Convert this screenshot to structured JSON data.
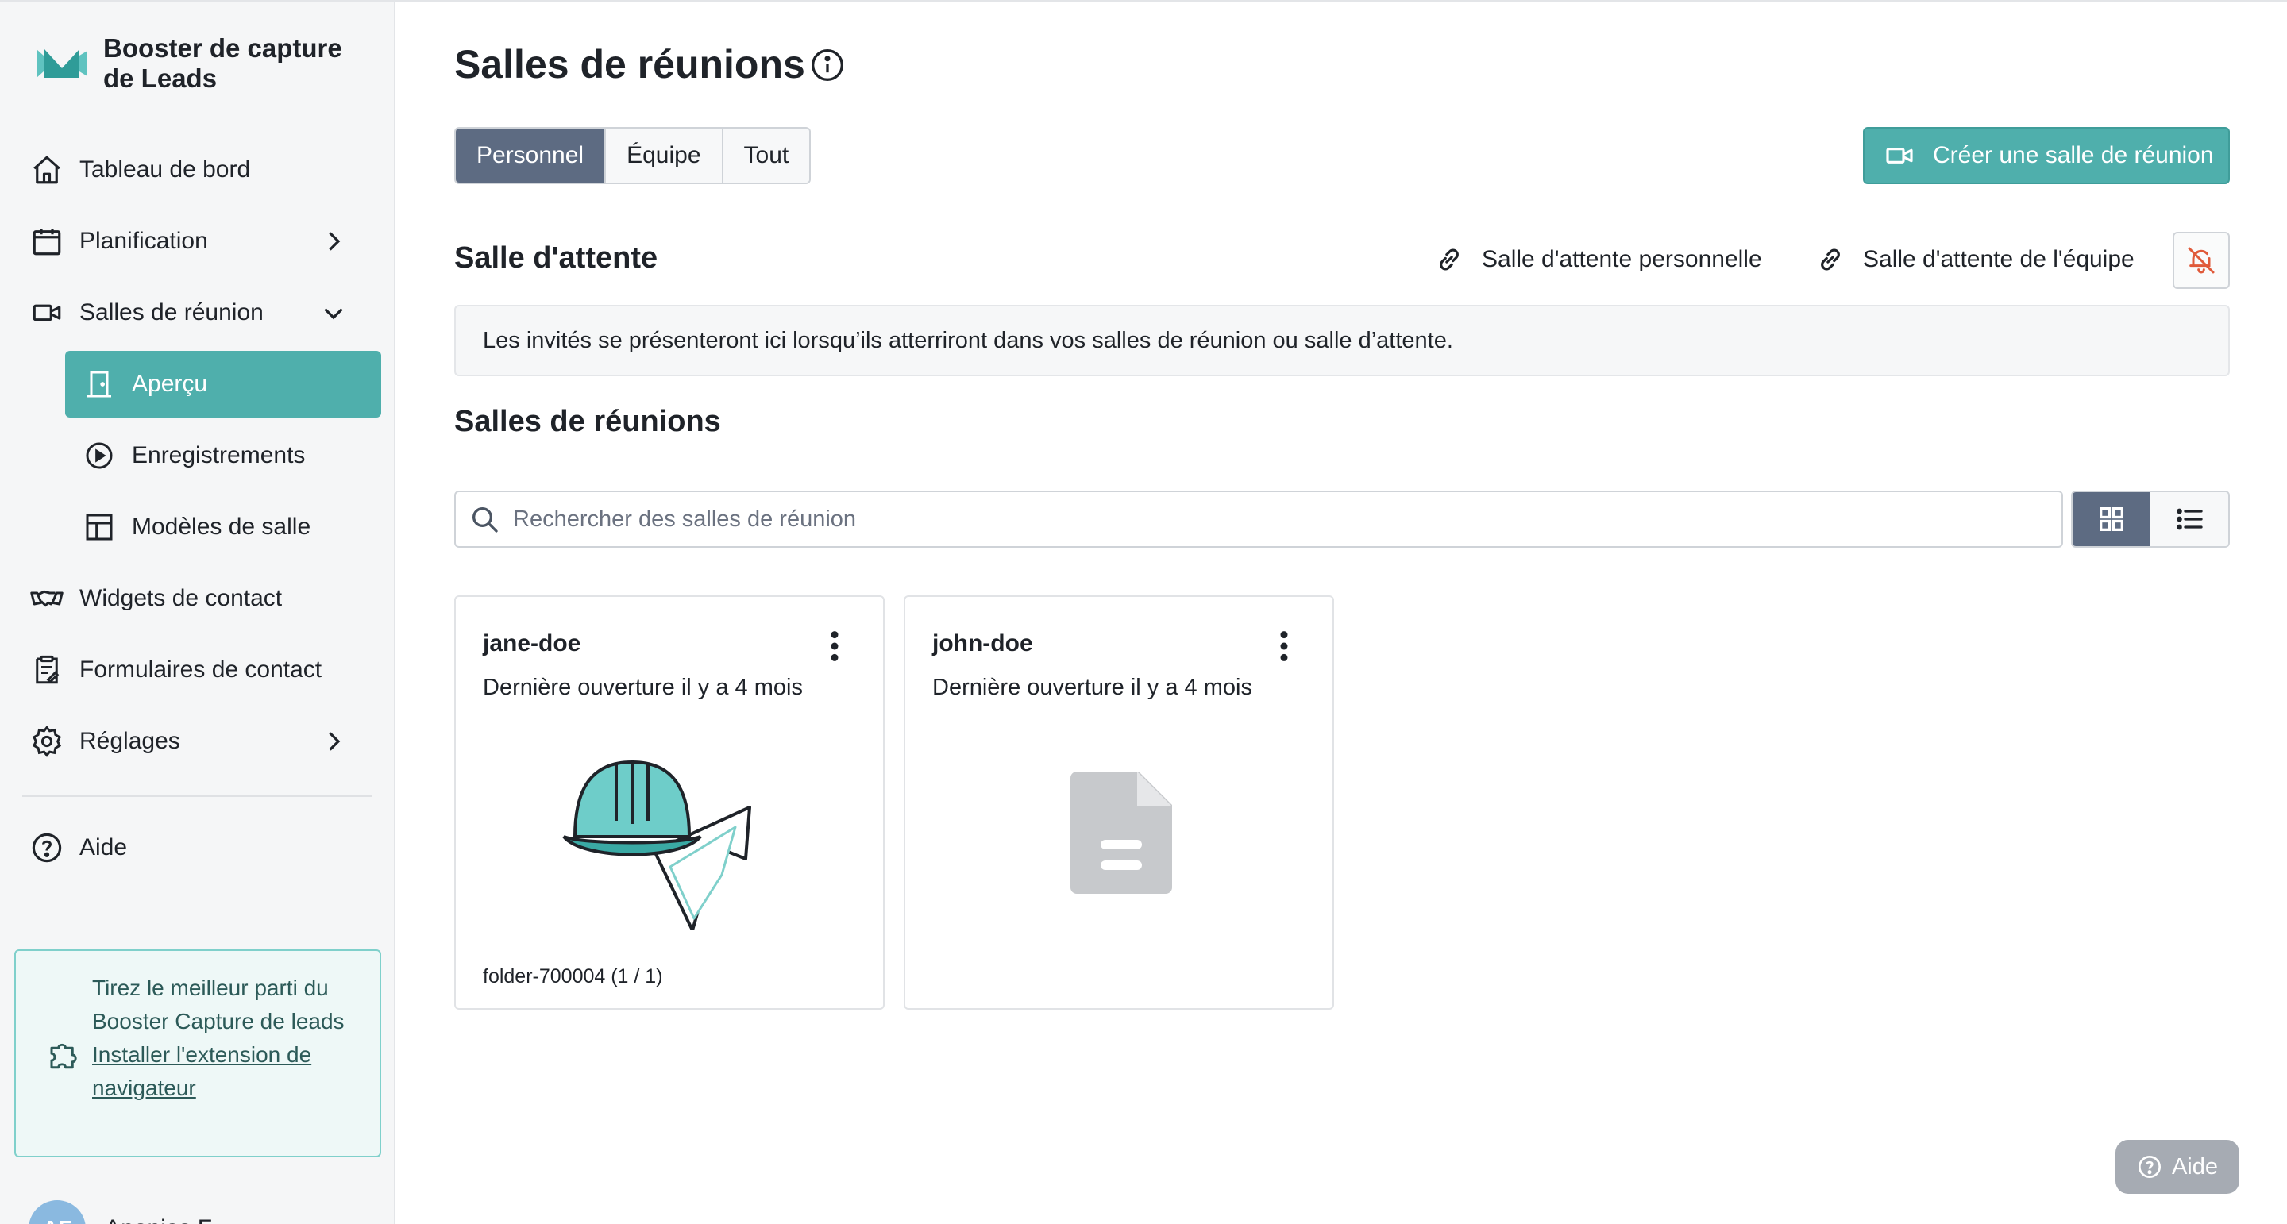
{
  "brand": {
    "name": "Booster de capture de Leads",
    "accent": "#4fafac"
  },
  "sidebar": {
    "items": [
      {
        "label": "Tableau de bord",
        "icon": "home-icon"
      },
      {
        "label": "Planification",
        "icon": "calendar-icon",
        "expandable": true
      },
      {
        "label": "Salles de réunion",
        "icon": "video-camera-icon",
        "expanded": true
      },
      {
        "label": "Aperçu",
        "icon": "door-icon",
        "active": true
      },
      {
        "label": "Enregistrements",
        "icon": "play-circle-icon"
      },
      {
        "label": "Modèles de salle",
        "icon": "template-icon"
      },
      {
        "label": "Widgets de contact",
        "icon": "handshake-icon"
      },
      {
        "label": "Formulaires de contact",
        "icon": "form-icon"
      },
      {
        "label": "Réglages",
        "icon": "gear-icon",
        "expandable": true
      },
      {
        "label": "Aide",
        "icon": "help-circle-icon"
      }
    ],
    "promo": {
      "text": "Tirez le meilleur parti du Booster Capture de leads",
      "link": "Installer l'extension de navigateur"
    },
    "user": {
      "initials": "AF",
      "name": "Ananias F"
    }
  },
  "main": {
    "title": "Salles de réunions",
    "tabs": [
      {
        "label": "Personnel",
        "active": true
      },
      {
        "label": "Équipe",
        "active": false
      },
      {
        "label": "Tout",
        "active": false
      }
    ],
    "create_button": "Créer une salle de réunion",
    "waiting": {
      "heading": "Salle d'attente",
      "personal_link": "Salle d'attente personnelle",
      "team_link": "Salle d'attente de l'équipe",
      "notice": "Les invités se présenteront ici lorsqu’ils atterriront dans vos salles de réunion ou salle d’attente."
    },
    "rooms_heading": "Salles de réunions",
    "search_placeholder": "Rechercher des salles de réunion",
    "view_mode": "grid",
    "rooms": [
      {
        "name": "jane-doe",
        "last_opened": "Dernière ouverture il y a 4 mois",
        "thumbnail": "hardhat-illustration",
        "footer": "folder-700004 (1 / 1)"
      },
      {
        "name": "john-doe",
        "last_opened": "Dernière ouverture il y a 4 mois",
        "thumbnail": "document-icon",
        "footer": ""
      }
    ]
  },
  "help_widget": {
    "label": "Aide"
  }
}
